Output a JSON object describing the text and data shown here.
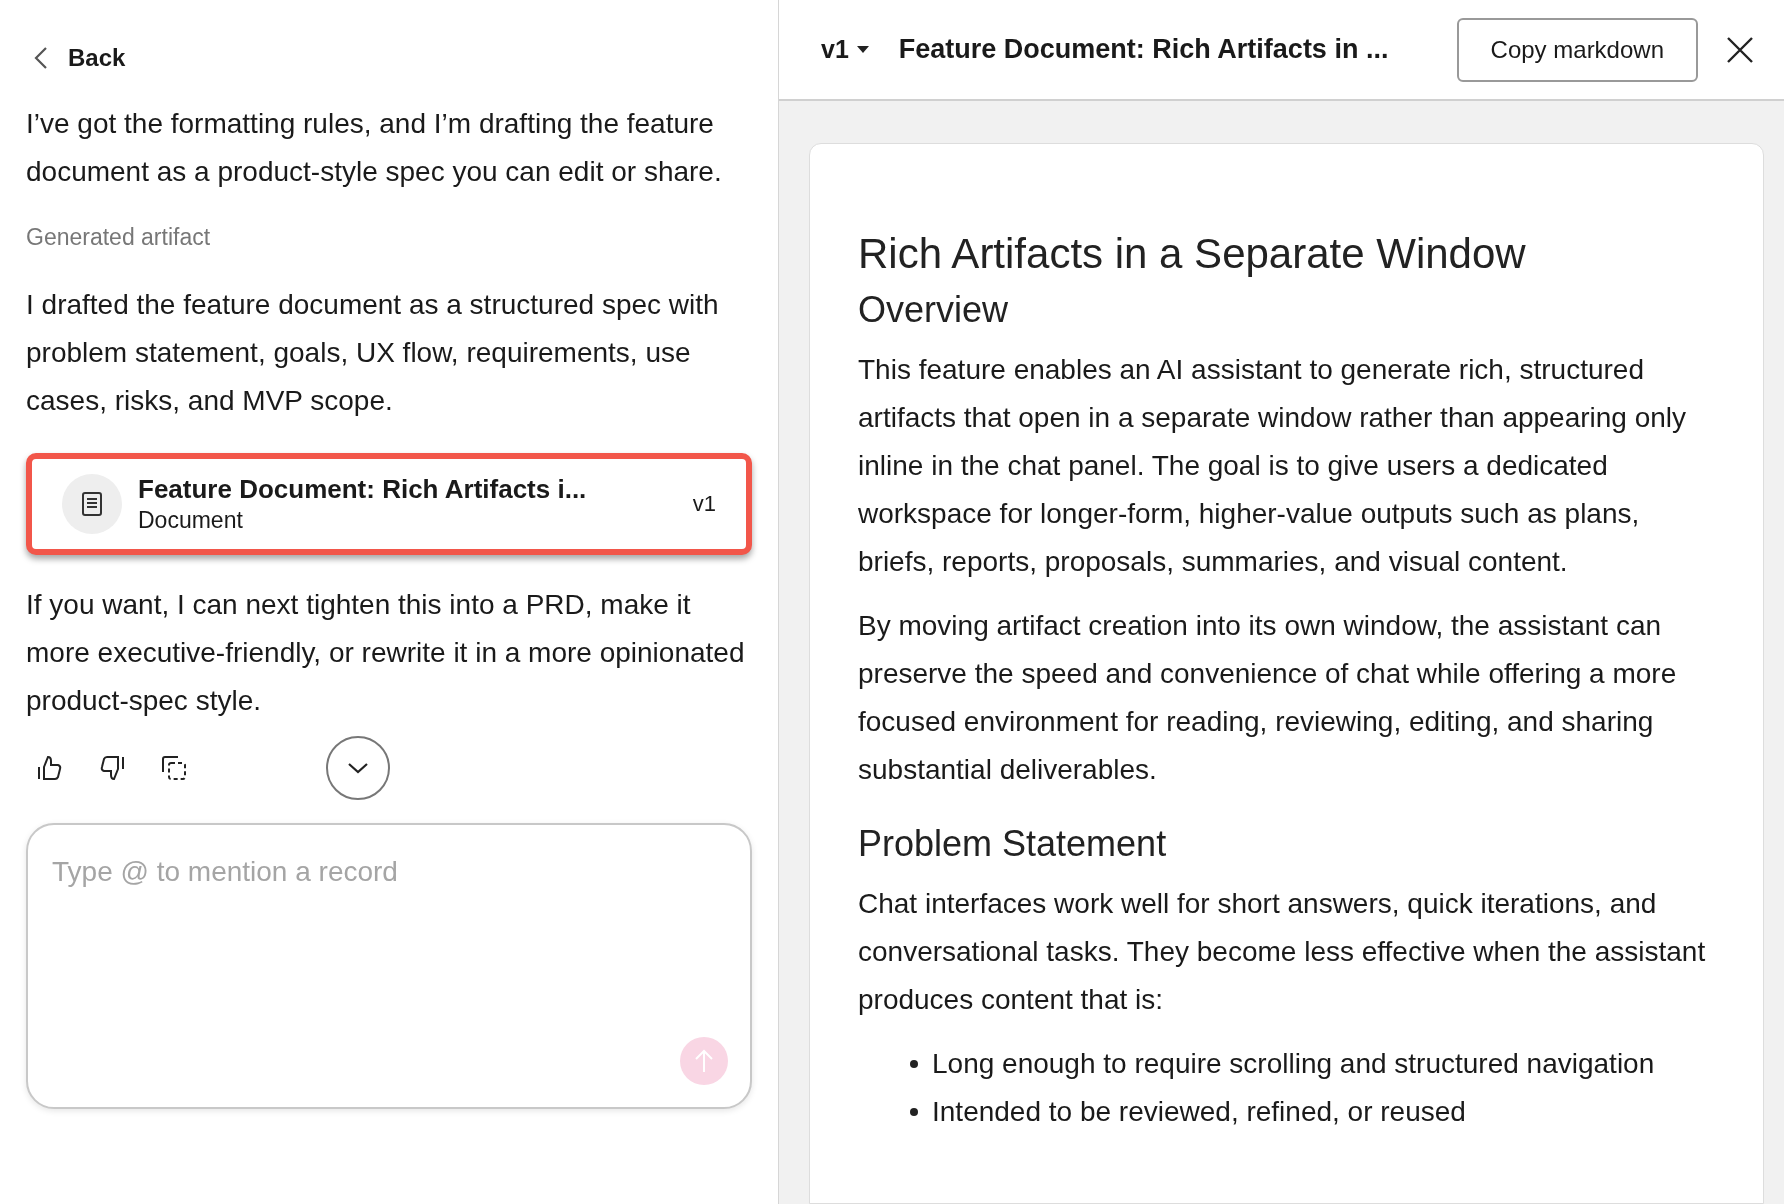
{
  "chat": {
    "back": "Back",
    "messages": [
      {
        "kind": "text",
        "text": "I’ve got the formatting rules, and I’m drafting the feature document as a product-style spec you can edit or share."
      },
      {
        "kind": "caption",
        "text": "Generated artifact"
      },
      {
        "kind": "text",
        "text": "I drafted the feature document as a structured spec with problem statement, goals, UX flow, requirements, use cases, risks, and MVP scope."
      },
      {
        "kind": "artifact",
        "title": "Feature Document: Rich Artifacts i...",
        "type": "Document",
        "version": "v1",
        "highlighted": true
      },
      {
        "kind": "text",
        "text": "If you want, I can next tighten this into a PRD, make it more executive-friendly, or rewrite it in a more opinionated product-spec style."
      }
    ],
    "composer": {
      "placeholder": "Type @ to mention a record"
    }
  },
  "artifact_panel": {
    "version": "v1",
    "title": "Feature Document: Rich Artifacts in ...",
    "copy_button": "Copy markdown",
    "document": [
      {
        "kind": "h1",
        "text": "Rich Artifacts in a Separate Window"
      },
      {
        "kind": "h2",
        "text": "Overview"
      },
      {
        "kind": "p",
        "text": "This feature enables an AI assistant to generate rich, structured artifacts that open in a separate window rather than appearing only inline in the chat panel. The goal is to give users a dedicated workspace for longer-form, higher-value outputs such as plans, briefs, reports, proposals, summaries, and visual content."
      },
      {
        "kind": "p",
        "text": "By moving artifact creation into its own window, the assistant can preserve the speed and convenience of chat while offering a more focused environment for reading, reviewing, editing, and sharing substantial deliverables."
      },
      {
        "kind": "h2",
        "text": "Problem Statement"
      },
      {
        "kind": "p",
        "text": "Chat interfaces work well for short answers, quick iterations, and conversational tasks. They become less effective when the assistant produces content that is:"
      },
      {
        "kind": "li",
        "text": "Long enough to require scrolling and structured navigation"
      },
      {
        "kind": "li",
        "text": "Intended to be reviewed, refined, or reused"
      }
    ]
  }
}
